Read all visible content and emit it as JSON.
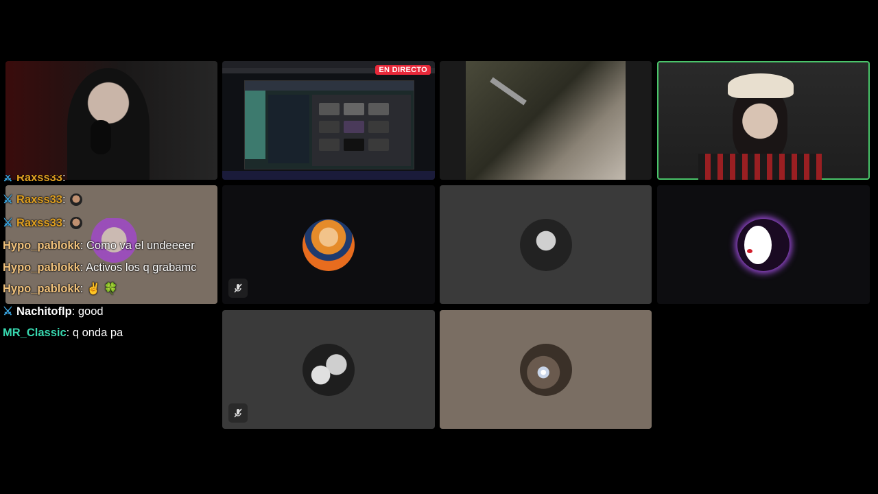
{
  "stream": {
    "live_badge": "EN DIRECTO"
  },
  "chat": {
    "messages": [
      {
        "user": "Raxss33",
        "text": "",
        "color": "#e0a021",
        "mod": true,
        "emote": "face-emote"
      },
      {
        "user": "Raxss33",
        "text": "",
        "color": "#e0a021",
        "mod": true,
        "emote": "face-emote"
      },
      {
        "user": "Raxss33",
        "text": "",
        "color": "#e0a021",
        "mod": true,
        "emote": "face-emote"
      },
      {
        "user": "Hypo_pablokk",
        "text": "Como va el undeeeer",
        "color": "#f1c27c",
        "mod": false
      },
      {
        "user": "Hypo_pablokk",
        "text": "Activos los q grabamc",
        "color": "#f1c27c",
        "mod": false
      },
      {
        "user": "Hypo_pablokk",
        "text": "✌️ 🍀",
        "color": "#f1c27c",
        "mod": false
      },
      {
        "user": "Nachitoflp",
        "text": "good",
        "color": "#ffffff",
        "mod": true
      },
      {
        "user": "MR_Classic",
        "text": "q onda pa",
        "color": "#38d9b0",
        "mod": false
      }
    ]
  },
  "participants": [
    {
      "name": "participant-naruto",
      "muted": true
    },
    {
      "name": "participant-boy-bw",
      "muted": false
    },
    {
      "name": "participant-purple-logo",
      "muted": false
    },
    {
      "name": "participant-couple-bw",
      "muted": true
    },
    {
      "name": "participant-flash-selfie",
      "muted": false
    }
  ],
  "colors": {
    "speaking_border": "#4ac46a",
    "tile_dark": "#161616",
    "tile_gray": "#3a3a3a",
    "tile_tan": "#7a6e63",
    "live_red": "#e8293a"
  }
}
